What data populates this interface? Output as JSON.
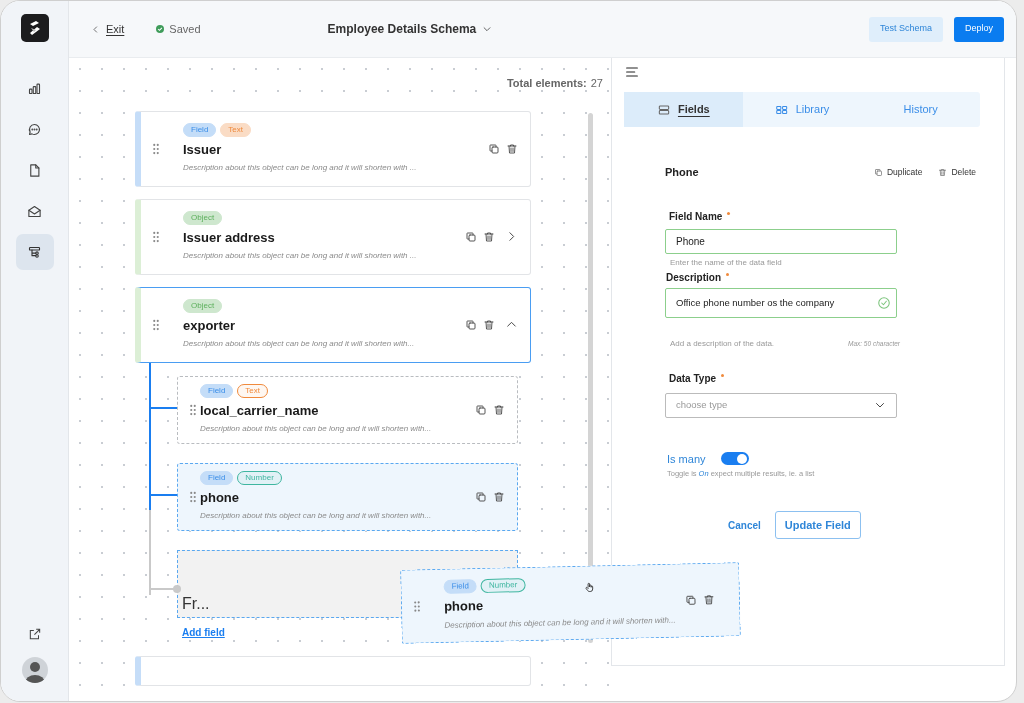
{
  "header": {
    "exit": "Exit",
    "save_status": "Saved",
    "schema_title": "Employee Details Schema",
    "buttons": [
      {
        "label": "Test Schema",
        "kind": "secondary"
      },
      {
        "label": "Deploy",
        "kind": "primary"
      }
    ]
  },
  "sidebar": {
    "items": [
      {
        "selected": false
      },
      {
        "selected": false
      },
      {
        "selected": false
      },
      {
        "selected": false
      },
      {
        "selected": true
      }
    ]
  },
  "canvas": {
    "total_label": "Total elements:",
    "total_value": "27",
    "elements": [
      {
        "kind": "field",
        "tags": [
          {
            "label": "Field",
            "color": "#c4ddf8",
            "outlined": false
          },
          {
            "label": "Text",
            "color": "#fadcc5",
            "outlined": false
          }
        ],
        "title": "Issuer",
        "description": "Description about this object can be long and it will shorten with ...",
        "selected": false
      },
      {
        "kind": "object",
        "tags": [
          {
            "label": "Object",
            "color": "#cee7ce",
            "outlined": false
          }
        ],
        "title": "Issuer address",
        "description": "Description about this object can be long and it will shorten with ...",
        "selected": false,
        "expanded": false
      },
      {
        "kind": "object",
        "tags": [
          {
            "label": "Object",
            "color": "#cee7ce",
            "outlined": false
          }
        ],
        "title": "exporter",
        "description": "Description about this object can be long and it will shorten with...",
        "selected": true,
        "expanded": true,
        "children": [
          {
            "kind": "field",
            "tags": [
              {
                "label": "Field",
                "color": "#c4ddf8",
                "outlined": false
              },
              {
                "label": "Text",
                "color": "#f08a3c",
                "outlined": true
              }
            ],
            "title": "local_carrier_name",
            "description": "Description about this object can be long and it will shorten with...",
            "selected": false
          },
          {
            "kind": "field",
            "tags": [
              {
                "label": "Field",
                "color": "#c4ddf8",
                "outlined": false
              },
              {
                "label": "Number",
                "color": "#3fb6a0",
                "outlined": true
              }
            ],
            "title": "phone",
            "description": "Description about this object can be long and it will shorten with...",
            "selected": true
          }
        ]
      }
    ],
    "drop_placeholder": "Fr...",
    "add_field": "Add field",
    "dragged": {
      "tags": [
        {
          "label": "Field",
          "color": "#c4ddf8",
          "outlined": false
        },
        {
          "label": "Number",
          "color": "#3fb6a0",
          "outlined": true
        }
      ],
      "title": "phone",
      "description": "Description about this object can be long and it will shorten with..."
    }
  },
  "panel": {
    "tabs": [
      {
        "label": "Fields",
        "selected": true
      },
      {
        "label": "Library",
        "selected": false
      },
      {
        "label": "History",
        "selected": false
      }
    ],
    "title": "Phone",
    "actions": [
      "Duplicate",
      "Delete"
    ],
    "field_name": {
      "label": "Field Name",
      "value": "Phone",
      "hint": "Enter the name of the data field",
      "valid": true
    },
    "description": {
      "label": "Description",
      "value": "Office phone number os the company",
      "hint": "Add a description of the data.",
      "counter": "Max: 50 character",
      "valid": true
    },
    "data_type": {
      "label": "Data Type",
      "placeholder": "choose type"
    },
    "toggle": {
      "label": "Is many",
      "on": true,
      "note_prefix": "Toggle is",
      "note_state": "On",
      "note_suffix": "expect multiple results, ie. a list"
    },
    "buttons": [
      {
        "label": "Cancel",
        "kind": "link"
      },
      {
        "label": "Update Field",
        "kind": "outline"
      }
    ]
  }
}
